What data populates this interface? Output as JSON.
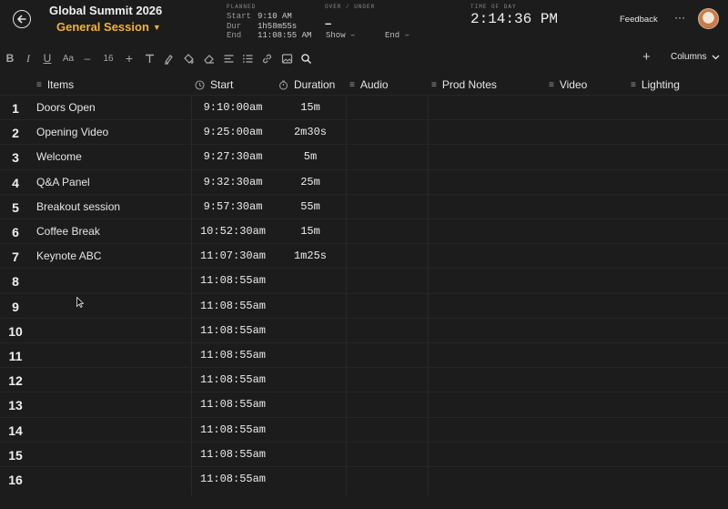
{
  "header": {
    "event_title": "Global Summit 2026",
    "session_title": "General Session",
    "planned": {
      "label": "PLANNED",
      "start_key": "Start",
      "start_val": "9:10 AM",
      "dur_key": "Dur",
      "dur_val": "1h58m55s",
      "end_key": "End",
      "end_val": "11:08:55 AM"
    },
    "over_under": {
      "label": "OVER / UNDER",
      "value": "–",
      "show": "Show –",
      "end": "End –"
    },
    "time_of_day": {
      "label": "TIME OF DAY",
      "value": "2:14:36 PM"
    },
    "feedback": "Feedback",
    "more": "···"
  },
  "toolbar": {
    "font_size": "16",
    "columns_label": "Columns",
    "icons": [
      "bold-icon",
      "italic-icon",
      "underline-icon",
      "text-case-icon",
      "minus-icon",
      "plus-icon",
      "text-icon",
      "highlight-icon",
      "fill-icon",
      "eraser-icon",
      "align-icon",
      "list-icon",
      "link-icon",
      "image-icon",
      "search-icon"
    ]
  },
  "columns": {
    "items": "Items",
    "start": "Start",
    "duration": "Duration",
    "audio": "Audio",
    "prod_notes": "Prod Notes",
    "video": "Video",
    "lighting": "Lighting"
  },
  "rows": [
    {
      "num": "1",
      "item": "Doors Open",
      "start": "9:10:00am",
      "duration": "15m"
    },
    {
      "num": "2",
      "item": "Opening Video",
      "start": "9:25:00am",
      "duration": "2m30s"
    },
    {
      "num": "3",
      "item": "Welcome",
      "start": "9:27:30am",
      "duration": "5m"
    },
    {
      "num": "4",
      "item": "Q&A Panel",
      "start": "9:32:30am",
      "duration": "25m"
    },
    {
      "num": "5",
      "item": "Breakout session",
      "start": "9:57:30am",
      "duration": "55m"
    },
    {
      "num": "6",
      "item": "Coffee Break",
      "start": "10:52:30am",
      "duration": "15m"
    },
    {
      "num": "7",
      "item": "Keynote ABC",
      "start": "11:07:30am",
      "duration": "1m25s"
    },
    {
      "num": "8",
      "item": "",
      "start": "11:08:55am",
      "duration": ""
    },
    {
      "num": "9",
      "item": "",
      "start": "11:08:55am",
      "duration": ""
    },
    {
      "num": "10",
      "item": "",
      "start": "11:08:55am",
      "duration": ""
    },
    {
      "num": "11",
      "item": "",
      "start": "11:08:55am",
      "duration": ""
    },
    {
      "num": "12",
      "item": "",
      "start": "11:08:55am",
      "duration": ""
    },
    {
      "num": "13",
      "item": "",
      "start": "11:08:55am",
      "duration": ""
    },
    {
      "num": "14",
      "item": "",
      "start": "11:08:55am",
      "duration": ""
    },
    {
      "num": "15",
      "item": "",
      "start": "11:08:55am",
      "duration": ""
    },
    {
      "num": "16",
      "item": "",
      "start": "11:08:55am",
      "duration": ""
    }
  ],
  "colors": {
    "background": "#1c1c1c",
    "accent": "#f2b233",
    "text": "#e6e6e6"
  }
}
